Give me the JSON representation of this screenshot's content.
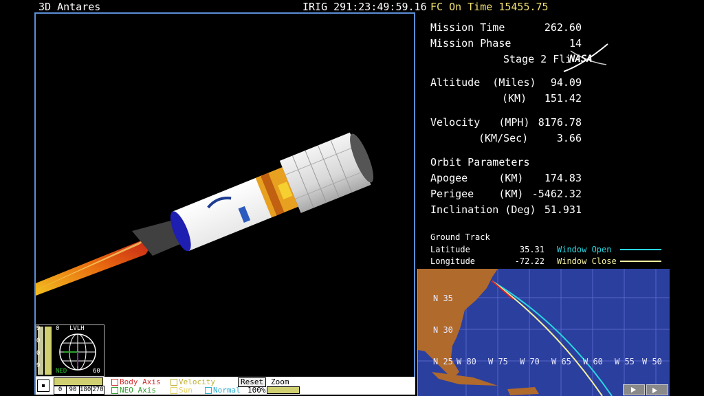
{
  "view": {
    "title": "3D Antares",
    "clock": "IRIG  291:23:49:59.16"
  },
  "telemetry": {
    "fc_on_time": "FC On Time 15455.75",
    "mission_time_label": "Mission Time",
    "mission_time": "262.60",
    "mission_phase_label": "Mission Phase",
    "mission_phase": "14",
    "phase_name": "Stage 2 Fli",
    "altitude_label": "Altitude  (Miles)",
    "altitude_miles": "94.09",
    "altitude_km_label": "(KM)",
    "altitude_km": "151.42",
    "velocity_label": "Velocity   (MPH)",
    "velocity_mph": "8176.78",
    "velocity_kms_label": "(KM/Sec)",
    "velocity_kms": "3.66",
    "orbit_label": "Orbit Parameters",
    "apogee_label": "Apogee     (KM)",
    "apogee": "174.83",
    "perigee_label": "Perigee    (KM)",
    "perigee": "-5462.32",
    "inclination_label": "Inclination (Deg)",
    "inclination": "51.931"
  },
  "ground_track": {
    "title": "Ground Track",
    "latitude_label": "Latitude",
    "latitude": "35.31",
    "longitude_label": "Longitude",
    "longitude": "-72.22",
    "window_open": "Window Open",
    "window_close": "Window Close",
    "window_open_color": "#29d6e0",
    "window_close_color": "#f4f0a0"
  },
  "map": {
    "lat_labels": [
      "N 35",
      "N 30",
      "N 25"
    ],
    "lon_labels": [
      "W 80",
      "W 75",
      "W 70",
      "W 65",
      "W 60",
      "W 55",
      "W 50"
    ]
  },
  "logo": "NASA",
  "hud": {
    "mode": "LVLH",
    "left_ticks": [
      "9",
      "0",
      "0",
      "9"
    ],
    "top_tick": "0",
    "neu": "NED",
    "right_tick": "60",
    "bottom_scale": [
      "0",
      "90",
      "180",
      "270"
    ]
  },
  "legend": {
    "body_axis": "Body Axis",
    "neo_axis": "NEO Axis",
    "velocity": "Velocity",
    "sun": "Sun",
    "normal": "Normal",
    "reset": "Reset",
    "zoom": "Zoom",
    "zoom_value": "100%",
    "body_color": "#d03030",
    "neo_color": "#30a030",
    "velocity_color": "#d0c030",
    "sun_color": "#e8d060",
    "normal_color": "#30b0d0"
  }
}
